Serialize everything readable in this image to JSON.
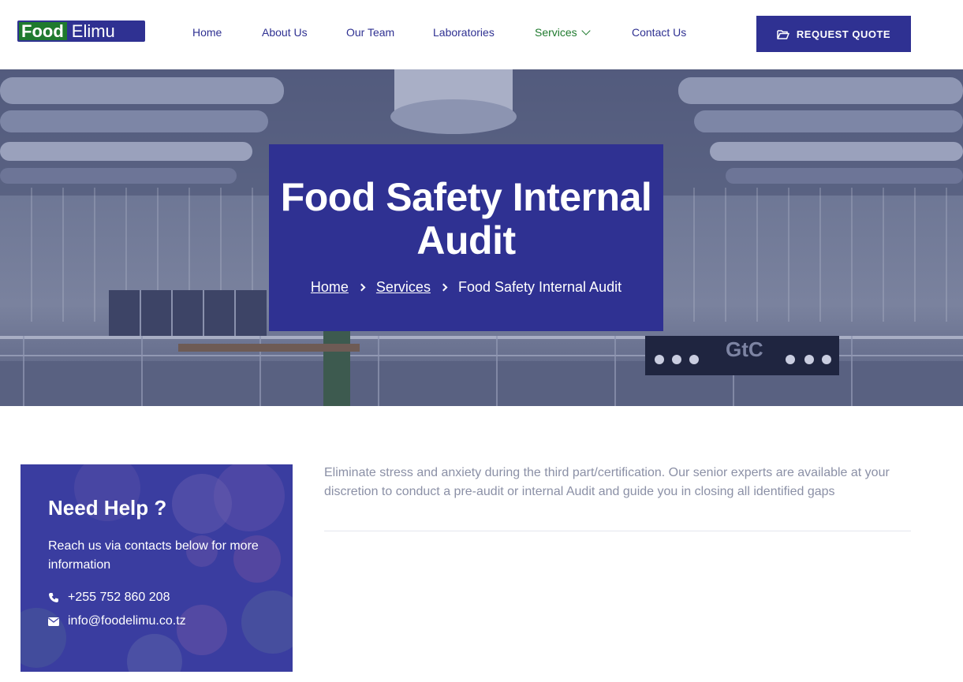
{
  "header": {
    "logo": {
      "part1": "Food",
      "part2": "Elimu"
    },
    "nav": [
      {
        "label": "Home"
      },
      {
        "label": "About Us"
      },
      {
        "label": "Our Team"
      },
      {
        "label": "Laboratories"
      },
      {
        "label": "Services",
        "active": true
      },
      {
        "label": "Contact Us"
      }
    ],
    "quote_button": "REQUEST QUOTE"
  },
  "hero": {
    "title_line1": "Food Safety Internal",
    "title_line2": "Audit",
    "breadcrumb": {
      "home": "Home",
      "services": "Services",
      "current": "Food Safety Internal Audit"
    }
  },
  "help": {
    "title": "Need Help ?",
    "text": "Reach us via contacts below for more information",
    "phone": "+255 752 860 208",
    "email": "info@foodelimu.co.tz"
  },
  "content": {
    "description": "Eliminate stress and anxiety during the third part/certification. Our senior experts are available at your discretion to conduct a pre-audit or internal Audit and guide you in closing all identified gaps"
  },
  "colors": {
    "brand_blue": "#2f3192",
    "brand_green": "#1f7a2e",
    "text_muted": "#8b90a6"
  }
}
